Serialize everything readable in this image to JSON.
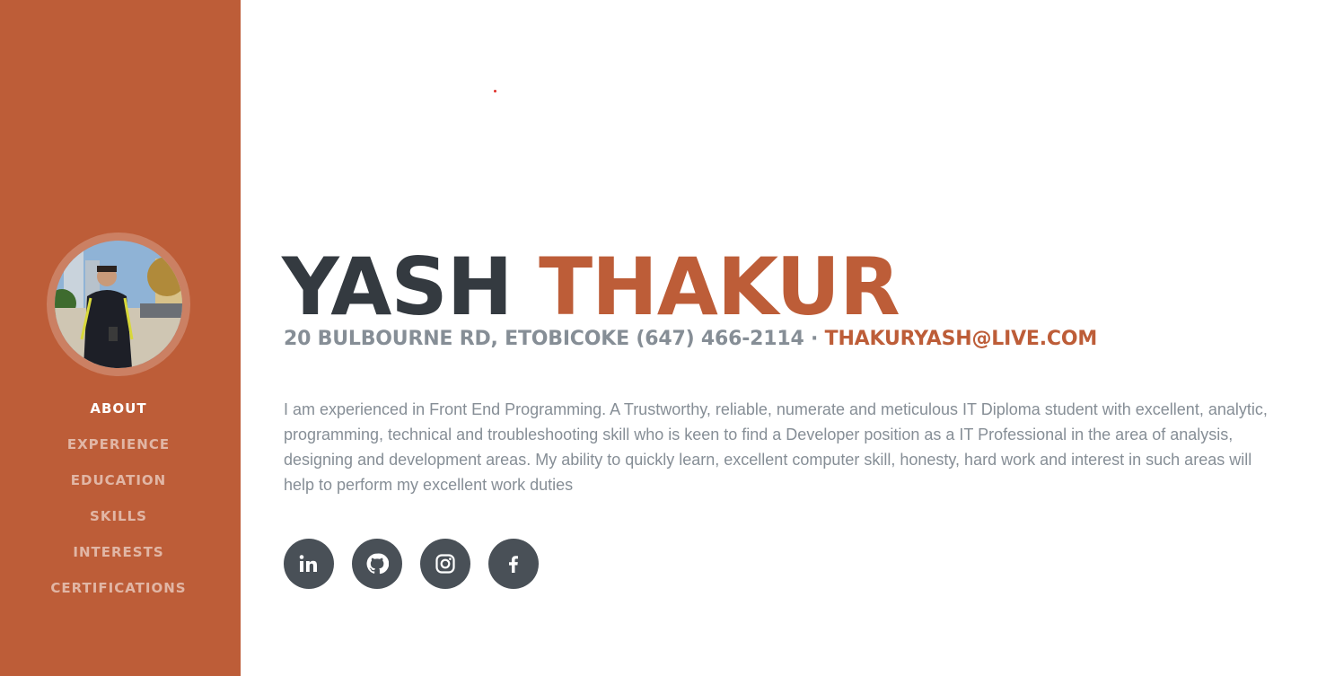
{
  "colors": {
    "primary": "#bd5d38",
    "dark": "#343a40",
    "muted": "#868e96",
    "social_bg": "#495057"
  },
  "sidebar": {
    "nav": [
      {
        "label": "ABOUT",
        "active": true
      },
      {
        "label": "EXPERIENCE",
        "active": false
      },
      {
        "label": "EDUCATION",
        "active": false
      },
      {
        "label": "SKILLS",
        "active": false
      },
      {
        "label": "INTERESTS",
        "active": false
      },
      {
        "label": "CERTIFICATIONS",
        "active": false
      }
    ]
  },
  "about": {
    "first_name": "YASH",
    "last_name": "THAKUR",
    "address": "20 BULBOURNE RD, ETOBICOKE (647) 466-2114 ·",
    "email": "THAKURYASH@LIVE.COM",
    "bio": "I am experienced in Front End Programming. A Trustworthy, reliable, numerate and meticulous IT Diploma student with excellent, analytic, programming, technical and troubleshooting skill who is keen to find a Developer position as a IT Professional in the area of analysis, designing and development areas. My ability to quickly learn, excellent computer skill, honesty, hard work and interest in such areas will help to perform my excellent work duties"
  },
  "social": [
    {
      "name": "linkedin-icon"
    },
    {
      "name": "github-icon"
    },
    {
      "name": "instagram-icon"
    },
    {
      "name": "facebook-icon"
    }
  ]
}
